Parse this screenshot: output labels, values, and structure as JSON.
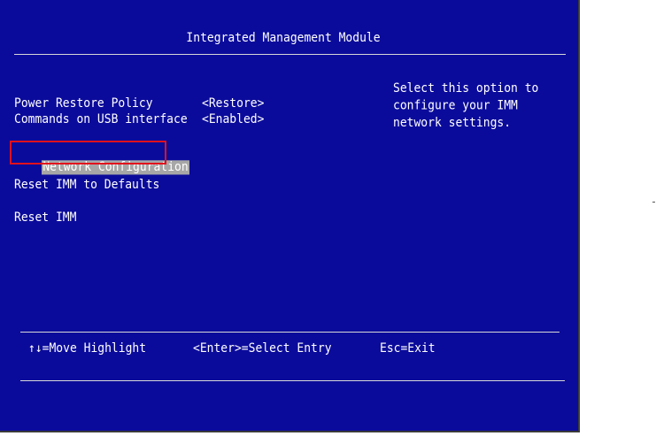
{
  "window": {
    "title": "Integrated Management Module"
  },
  "menu": {
    "items": [
      {
        "label": "Power Restore Policy",
        "value": "<Restore>"
      },
      {
        "label": "Commands on USB interface",
        "value": "<Enabled>"
      },
      {
        "label": "Network Configuration",
        "selected": true
      },
      {
        "label": "Reset IMM to Defaults"
      },
      {
        "label": "Reset IMM"
      }
    ]
  },
  "help": {
    "lines": [
      "Select this option to",
      "configure your IMM",
      "network settings."
    ]
  },
  "footer": {
    "move": "↑↓=Move Highlight",
    "select": "<Enter>=Select Entry",
    "exit": "Esc=Exit"
  },
  "colors": {
    "background": "#0b0b9b",
    "text": "#ffffff",
    "selection": "#a7a7a7",
    "annotation": "#e1101c"
  }
}
